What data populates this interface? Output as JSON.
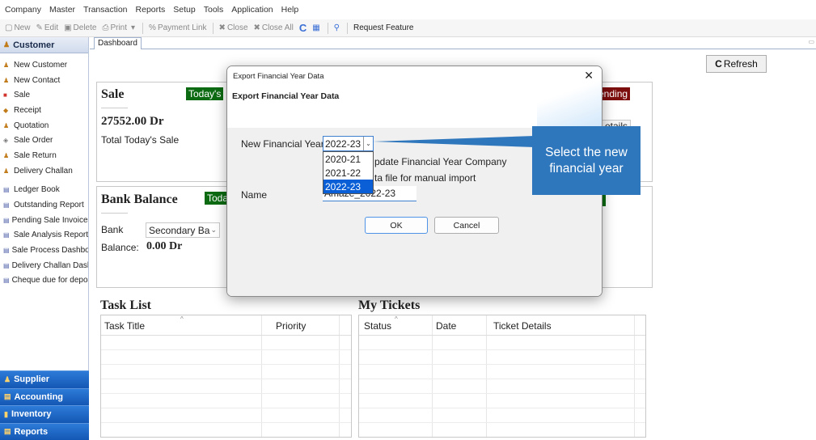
{
  "menu": [
    "Company",
    "Master",
    "Transaction",
    "Reports",
    "Setup",
    "Tools",
    "Application",
    "Help"
  ],
  "toolbar": {
    "new": "New",
    "edit": "Edit",
    "delete": "Delete",
    "print": "Print",
    "payment_link": "Payment Link",
    "close": "Close",
    "close_all": "Close All",
    "request_feature": "Request Feature"
  },
  "sidebar": {
    "header": "Customer",
    "items": [
      {
        "label": "New Customer"
      },
      {
        "label": "New Contact"
      },
      {
        "label": "Sale"
      },
      {
        "label": "Receipt"
      },
      {
        "label": "Quotation"
      },
      {
        "label": "Sale Order"
      },
      {
        "label": "Sale Return"
      },
      {
        "label": "Delivery Challan"
      },
      {
        "label": "Ledger Book"
      },
      {
        "label": "Outstanding Report"
      },
      {
        "label": "Pending Sale Invoices"
      },
      {
        "label": "Sale Analysis Report"
      },
      {
        "label": "Sale Process Dashboa"
      },
      {
        "label": "Delivery Challan Dashl"
      },
      {
        "label": "Cheque due for depos"
      }
    ],
    "bottom": [
      "Supplier",
      "Accounting",
      "Inventory",
      "Reports"
    ]
  },
  "tab": {
    "label": "Dashboard"
  },
  "dashboard": {
    "refresh": "Refresh",
    "sale": {
      "title": "Sale",
      "badge": "Today's",
      "amount": "27552.00 Dr",
      "caption": "Total Today's Sale",
      "pending": "ending",
      "details": "etails"
    },
    "bank": {
      "title": "Bank Balance",
      "badge": "Toda",
      "bank_label": "Bank",
      "bank_value": "Secondary Ba",
      "balance_label": "Balance:",
      "balance_value": "0.00 Dr"
    },
    "task_list": {
      "title": "Task List",
      "columns": [
        "Task Title",
        "Priority"
      ]
    },
    "tickets": {
      "title": "My Tickets",
      "columns": [
        "Status",
        "Date",
        "Ticket Details"
      ]
    }
  },
  "dialog": {
    "caption": "Export Financial Year Data",
    "heading": "Export Financial Year Data",
    "fy_label": "New Financial Year",
    "fy_selected": "2022-23",
    "fy_options": [
      "2020-21",
      "2021-22",
      "2022-23"
    ],
    "update_text": "pdate Financial Year Company",
    "data_file_text": "ta file for manual import",
    "name_label": "Name",
    "name_value": "Amaze_2022-23",
    "ok": "OK",
    "cancel": "Cancel"
  },
  "callout": {
    "text": "Select the new financial year"
  }
}
